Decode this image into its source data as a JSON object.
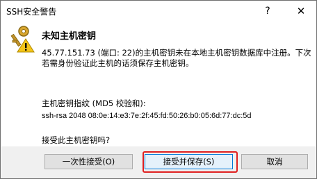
{
  "window": {
    "title": "SSH安全警告",
    "help_glyph": "?",
    "close_glyph": "✕"
  },
  "dialog": {
    "heading": "未知主机密钥",
    "message": "45.77.151.73 (端口: 22)的主机密钥未在本地主机密钥数据库中注册。下次若需身份验证此主机的话须保存主机密钥。",
    "fingerprint_label": "主机密钥指纹 (MD5 校验和):",
    "fingerprint_value": "ssh-rsa 2048 08:0e:14:e3:7e:2f:45:fd:50:26:b0:05:6d:77:dc:5d",
    "accept_question": "接受此主机密钥吗?",
    "icon": "key-warning-icon"
  },
  "buttons": {
    "accept_once": "一次性接受(O)",
    "accept_and_save": "接受并保存(S)",
    "cancel": "取消"
  },
  "colors": {
    "highlight": "#e02020",
    "footer_bg": "#f0f0f0",
    "focus_border": "#0078d7"
  }
}
